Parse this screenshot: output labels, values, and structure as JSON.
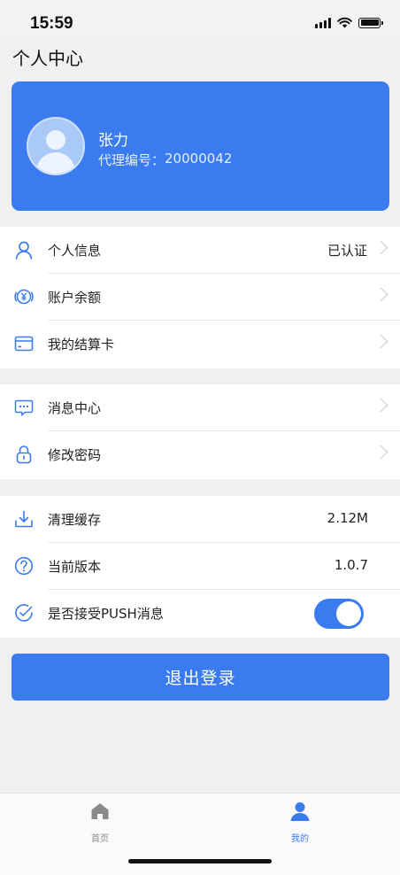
{
  "status_bar": {
    "time": "15:59"
  },
  "page_title": "个人中心",
  "profile": {
    "name": "张力",
    "id_label": "代理编号：",
    "id_value": "20000042"
  },
  "groups": [
    {
      "rows": [
        {
          "label": "个人信息",
          "value": "已认证",
          "icon": "user-icon",
          "chevron": true
        },
        {
          "label": "账户余额",
          "value": "",
          "icon": "yuan-coin-icon",
          "chevron": true
        },
        {
          "label": "我的结算卡",
          "value": "",
          "icon": "card-icon",
          "chevron": true
        }
      ]
    },
    {
      "rows": [
        {
          "label": "消息中心",
          "value": "",
          "icon": "message-icon",
          "chevron": true
        },
        {
          "label": "修改密码",
          "value": "",
          "icon": "lock-icon",
          "chevron": true
        }
      ]
    },
    {
      "rows": [
        {
          "label": "清理缓存",
          "value": "2.12M",
          "icon": "download-icon",
          "chevron": false
        },
        {
          "label": "当前版本",
          "value": "1.0.7",
          "icon": "help-icon",
          "chevron": false
        },
        {
          "label": "是否接受PUSH消息",
          "value": "",
          "icon": "check-circle-icon",
          "toggle": true,
          "toggle_on": true
        }
      ]
    }
  ],
  "logout_label": "退出登录",
  "tabs": [
    {
      "label": "首页",
      "icon": "home-icon",
      "active": false
    },
    {
      "label": "我的",
      "icon": "person-icon",
      "active": true
    }
  ],
  "colors": {
    "accent": "#3a7bf0",
    "inactive": "#8a8a8a",
    "background": "#f0f0f0"
  }
}
